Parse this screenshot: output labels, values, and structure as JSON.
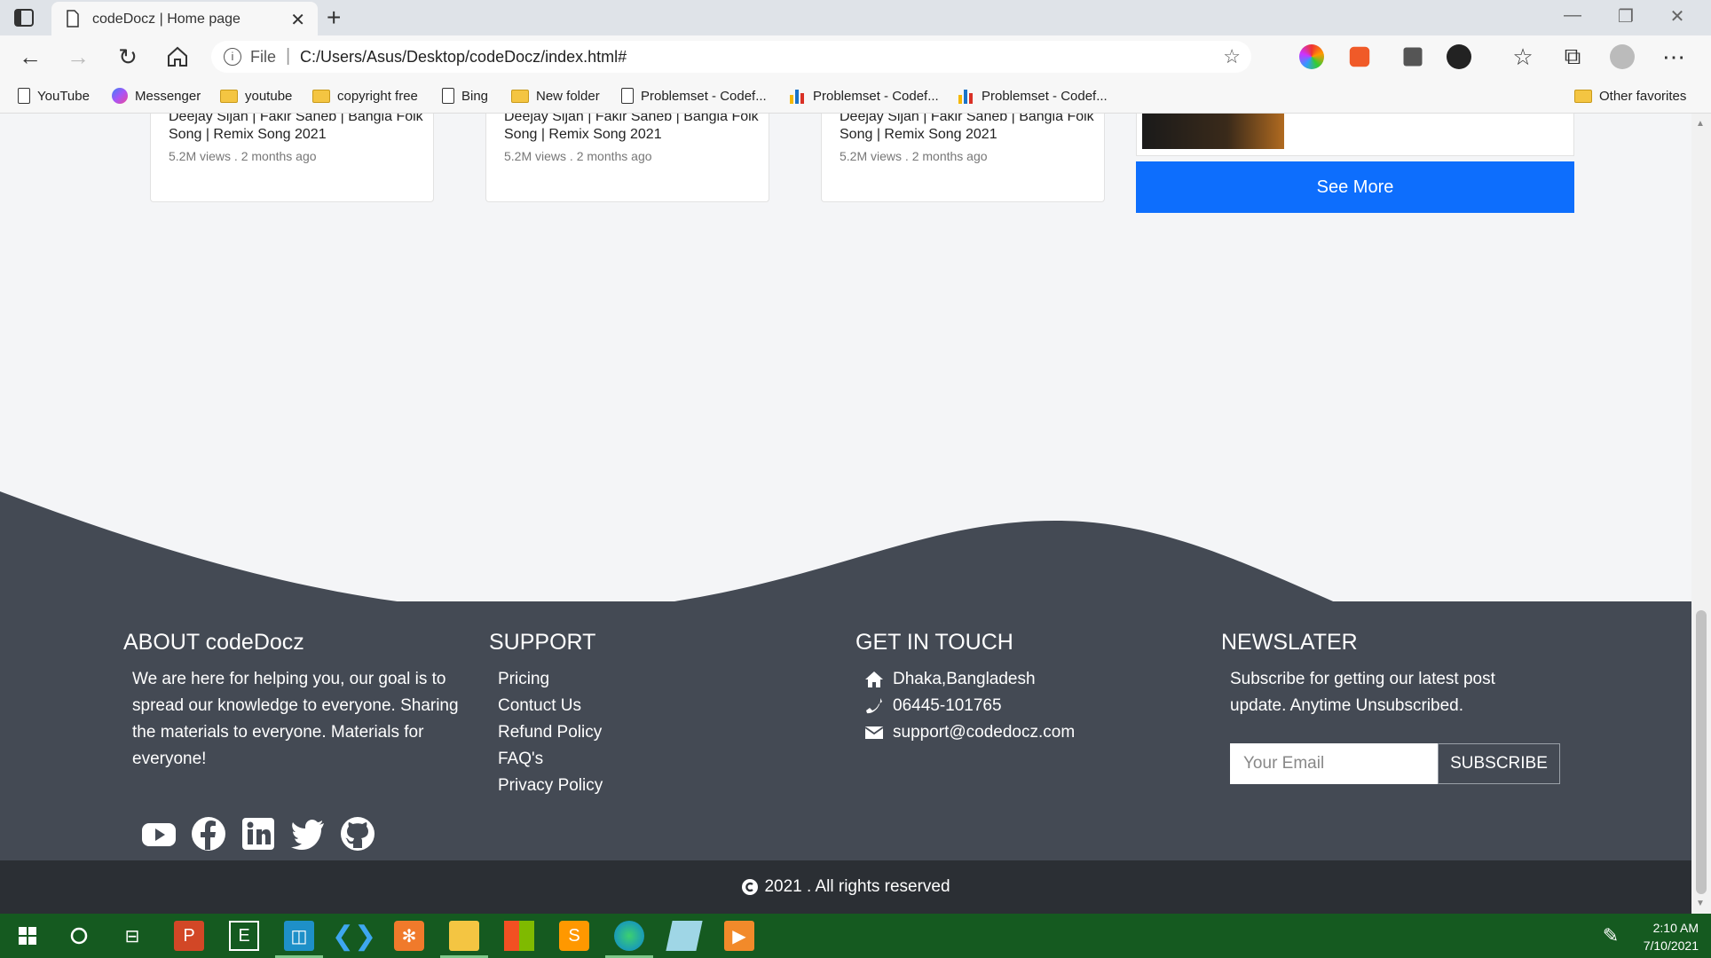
{
  "browser": {
    "tab_title": "codeDocz | Home page",
    "tab_close": "✕",
    "new_tab": "+",
    "url_scheme": "File",
    "url": "C:/Users/Asus/Desktop/codeDocz/index.html#",
    "bookmarks": [
      "YouTube",
      "Messenger",
      "youtube",
      "copyright free",
      "Bing",
      "New folder",
      "Problemset - Codef...",
      "Problemset - Codef...",
      "Problemset - Codef..."
    ],
    "other_favorites": "Other favorites"
  },
  "cards": [
    {
      "title": "Deejay Sijan | Fakir Saheb | Bangla Folk Song | Remix Song 2021",
      "meta": "5.2M views . 2 months ago"
    },
    {
      "title": "Deejay Sijan | Fakir Saheb | Bangla Folk Song | Remix Song 2021",
      "meta": "5.2M views . 2 months ago"
    },
    {
      "title": "Deejay Sijan | Fakir Saheb | Bangla Folk Song | Remix Song 2021",
      "meta": "5.2M views . 2 months ago"
    }
  ],
  "see_more": "See More",
  "footer": {
    "about": {
      "heading": "ABOUT codeDocz",
      "text": "We are here for helping you, our goal is to spread our knowledge to everyone. Sharing the materials to everyone. Materials for everyone!"
    },
    "support": {
      "heading": "SUPPORT",
      "links": [
        "Pricing",
        "Contuct Us",
        "Refund Policy",
        "FAQ's",
        "Privacy Policy"
      ]
    },
    "contact": {
      "heading": "GET IN TOUCH",
      "address": "Dhaka,Bangladesh",
      "phone": "06445-101765",
      "email": "support@codedocz.com"
    },
    "newsletter": {
      "heading": "NEWSLATER",
      "text": "Subscribe for getting our latest post update. Anytime Unsubscribed.",
      "placeholder": "Your Email",
      "button": "SUBSCRIBE"
    },
    "copyright": "2021 . All rights reserved"
  },
  "taskbar": {
    "time": "2:10 AM",
    "date": "7/10/2021"
  },
  "colors": {
    "primary": "#0d6efd",
    "footer_bg": "#444a54",
    "copyright_bg": "#2b2f34",
    "taskbar_bg": "#155a20"
  }
}
